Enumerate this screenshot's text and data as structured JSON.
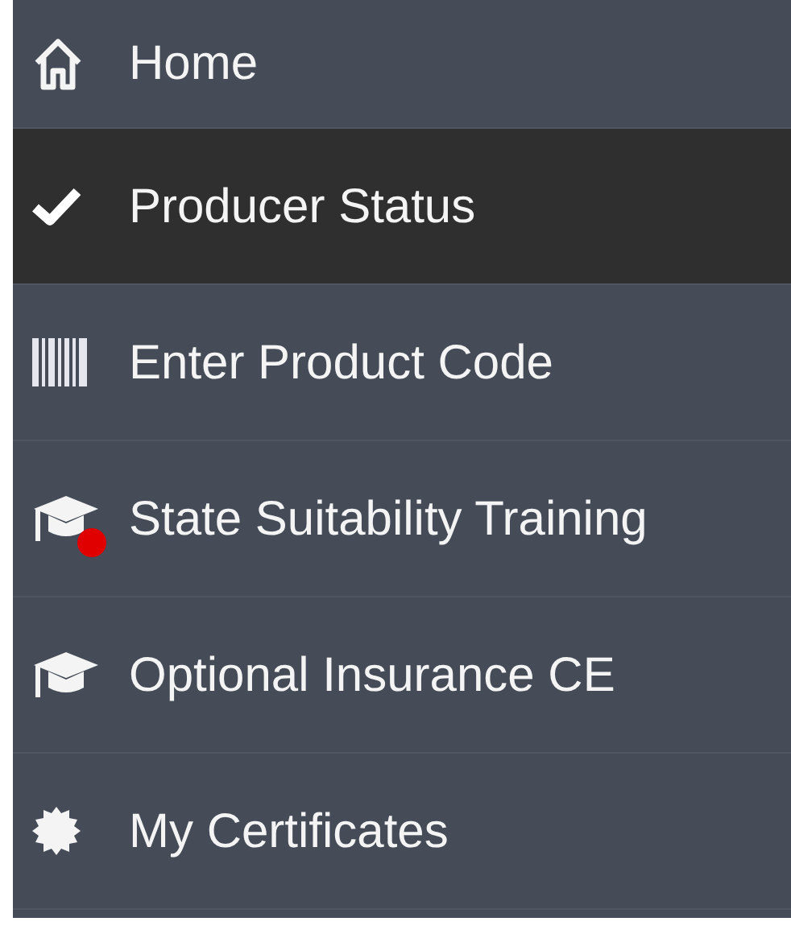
{
  "menu": [
    {
      "label": "Home",
      "selected": false,
      "alert": false
    },
    {
      "label": "Producer Status",
      "selected": true,
      "alert": false
    },
    {
      "label": "Enter Product Code",
      "selected": false,
      "alert": false
    },
    {
      "label": "State Suitability Training",
      "selected": false,
      "alert": true
    },
    {
      "label": "Optional Insurance CE",
      "selected": false,
      "alert": false
    },
    {
      "label": "My Certificates",
      "selected": false,
      "alert": false
    }
  ]
}
